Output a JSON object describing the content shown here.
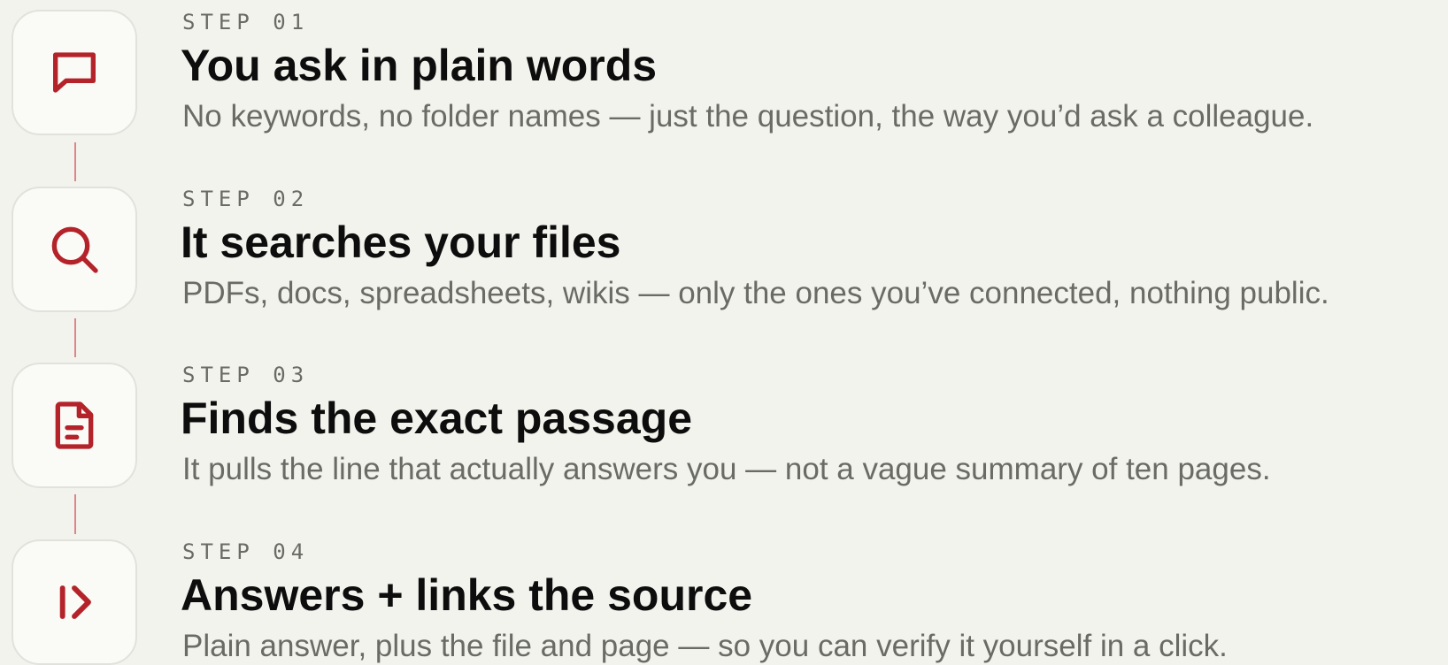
{
  "accent_color": "#b4232a",
  "steps": [
    {
      "kicker": "STEP 01",
      "title": "You ask in plain words",
      "description": "No keywords, no folder names — just the question, the way you’d ask a colleague.",
      "icon": "chat-bubble-icon"
    },
    {
      "kicker": "STEP 02",
      "title": "It searches your files",
      "description": "PDFs, docs, spreadsheets, wikis — only the ones you’ve connected, nothing public.",
      "icon": "search-icon"
    },
    {
      "kicker": "STEP 03",
      "title": "Finds the exact passage",
      "description": "It pulls the line that actually answers you — not a vague summary of ten pages.",
      "icon": "document-icon"
    },
    {
      "kicker": "STEP 04",
      "title": "Answers + links the source",
      "description": "Plain answer, plus the file and page — so you can verify it yourself in a click.",
      "icon": "answer-arrow-icon"
    }
  ]
}
